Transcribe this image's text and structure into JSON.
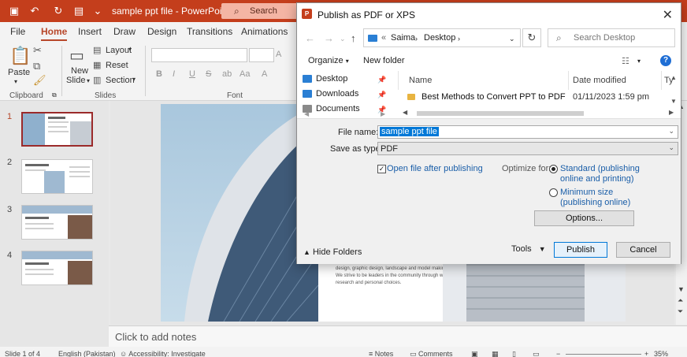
{
  "app": {
    "file_name": "sample ppt file",
    "separator": " - ",
    "app_name": "PowerPoint",
    "search_placeholder": "Search"
  },
  "ribbon": {
    "tabs": [
      "File",
      "Home",
      "Insert",
      "Draw",
      "Design",
      "Transitions",
      "Animations"
    ],
    "active_tab": "Home",
    "clipboard": {
      "paste": "Paste",
      "label": "Clipboard"
    },
    "slides": {
      "new_slide_1": "New",
      "new_slide_2": "Slide",
      "layout": "Layout",
      "reset": "Reset",
      "section": "Section",
      "label": "Slides"
    },
    "font": {
      "bold": "B",
      "italic": "I",
      "underline": "U",
      "strike": "S",
      "label": "Font"
    }
  },
  "thumbnails": [
    {
      "num": "1",
      "selected": true
    },
    {
      "num": "2",
      "selected": false
    },
    {
      "num": "3",
      "selected": false
    },
    {
      "num": "4",
      "selected": false
    }
  ],
  "slide": {
    "body_text": "internationally. Our firm houses their architecture, interior design, graphic design, landscape and model making staff. We strive to be leaders in the community through work, research and personal choices."
  },
  "notes": {
    "placeholder": "Click to add notes"
  },
  "status": {
    "slide_info": "Slide 1 of 4",
    "language": "English (Pakistan)",
    "accessibility": "Accessibility: Investigate",
    "notes": "Notes",
    "comments": "Comments",
    "zoom": "35%"
  },
  "dialog": {
    "title": "Publish as PDF or XPS",
    "address": {
      "prefix": "«",
      "segments": [
        "Saima",
        "Desktop"
      ]
    },
    "search_placeholder": "Search Desktop",
    "organize": "Organize",
    "new_folder": "New folder",
    "nav_items": [
      {
        "label": "Desktop",
        "color": "#2a7fd4"
      },
      {
        "label": "Downloads",
        "color": "#2a7fd4"
      },
      {
        "label": "Documents",
        "color": "#8a8a8a"
      }
    ],
    "columns": {
      "name": "Name",
      "date": "Date modified",
      "type": "Ty"
    },
    "files": [
      {
        "name": "Best Methods to Convert PPT to PDF",
        "date": "01/11/2023 1:59 pm"
      }
    ],
    "file_name_label": "File name:",
    "file_name_value": "sample ppt file",
    "save_type_label": "Save as type:",
    "save_type_value": "PDF",
    "open_after": "Open file after publishing",
    "open_after_checked": true,
    "optimize_label": "Optimize for:",
    "standard_1": "Standard (publishing",
    "standard_2": "online and printing)",
    "minimum_1": "Minimum size",
    "minimum_2": "(publishing online)",
    "options_button": "Options...",
    "hide_folders": "Hide Folders",
    "tools": "Tools",
    "publish": "Publish",
    "cancel": "Cancel"
  }
}
